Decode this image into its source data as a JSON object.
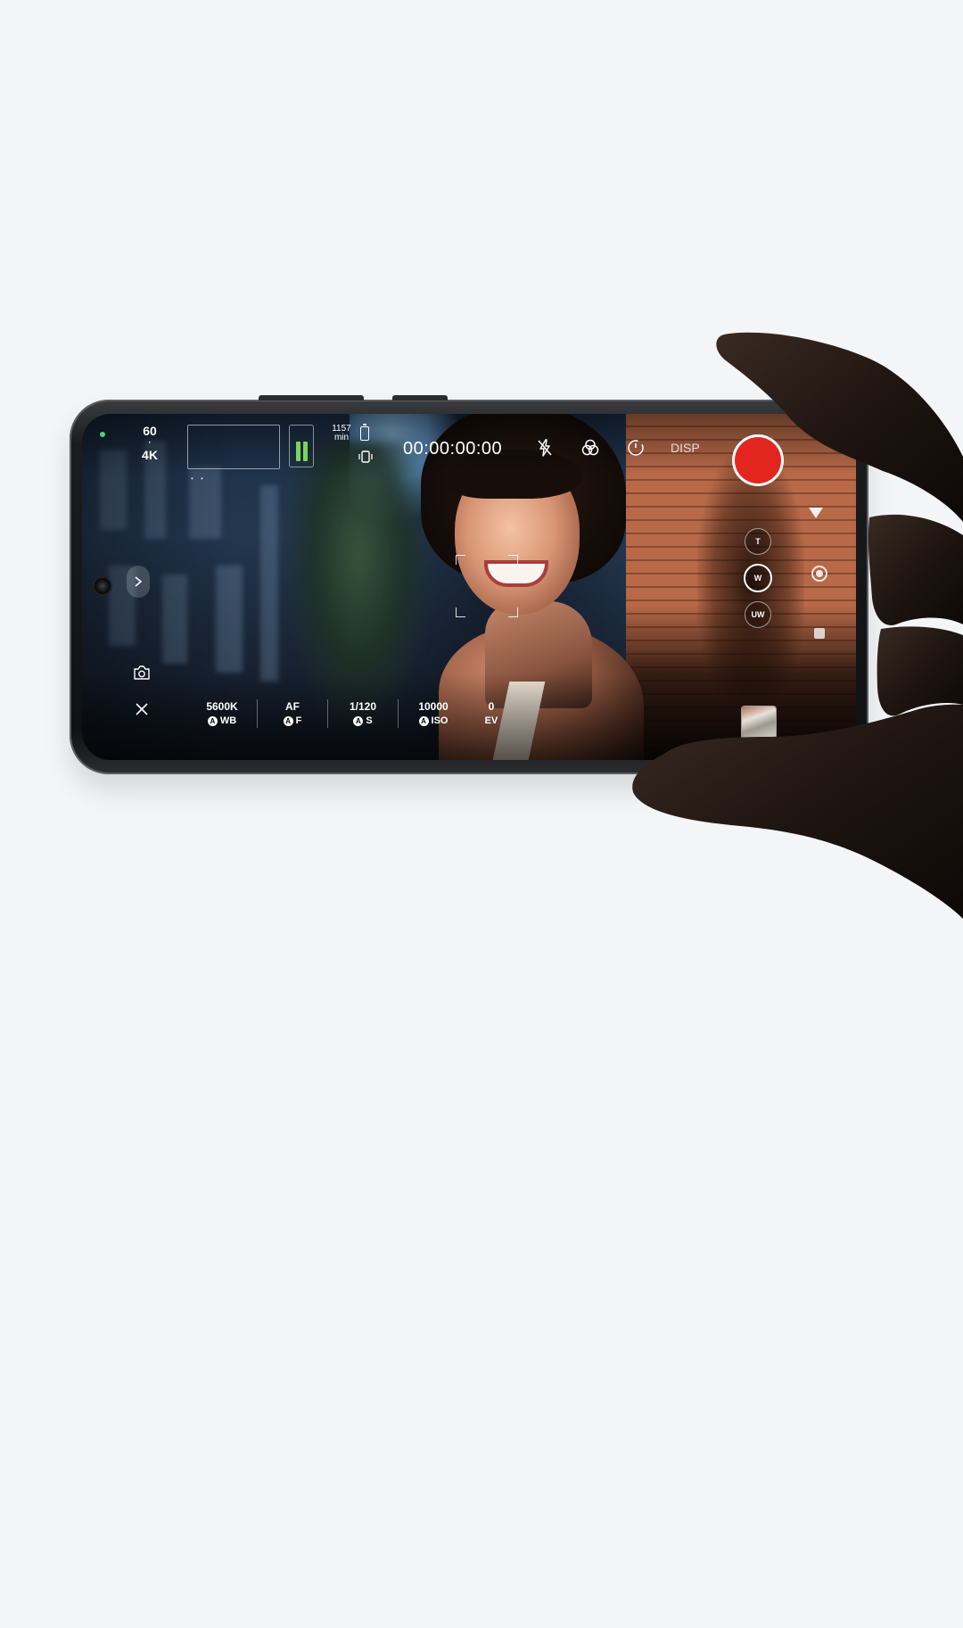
{
  "viewfinder": {
    "frame_rate": "60",
    "separator": "·",
    "resolution": "4K",
    "remaining_time": {
      "value": "1157",
      "unit": "min"
    },
    "timecode": "00:00:00:00",
    "disp_label": "DISP",
    "audio_dots": "• •"
  },
  "top_controls": {
    "icons": [
      "flash-off-icon",
      "color-filter-icon",
      "timer-icon"
    ]
  },
  "lenses": [
    {
      "label": "T",
      "active": false
    },
    {
      "label": "W",
      "active": true
    },
    {
      "label": "UW",
      "active": false
    }
  ],
  "parameters": [
    {
      "value": "5600K",
      "auto": "A",
      "label": "WB"
    },
    {
      "value": "AF",
      "auto": "A",
      "label": "F"
    },
    {
      "value": "1/120",
      "auto": "A",
      "label": "S"
    },
    {
      "value": "10000",
      "auto": "A",
      "label": "ISO"
    },
    {
      "value": "0",
      "auto": "",
      "label": "EV"
    }
  ],
  "colors": {
    "record": "#e3251f",
    "audio_level": "#7cd35a",
    "status_dot": "#4cd36a",
    "page_background": "#f4f5f7"
  }
}
